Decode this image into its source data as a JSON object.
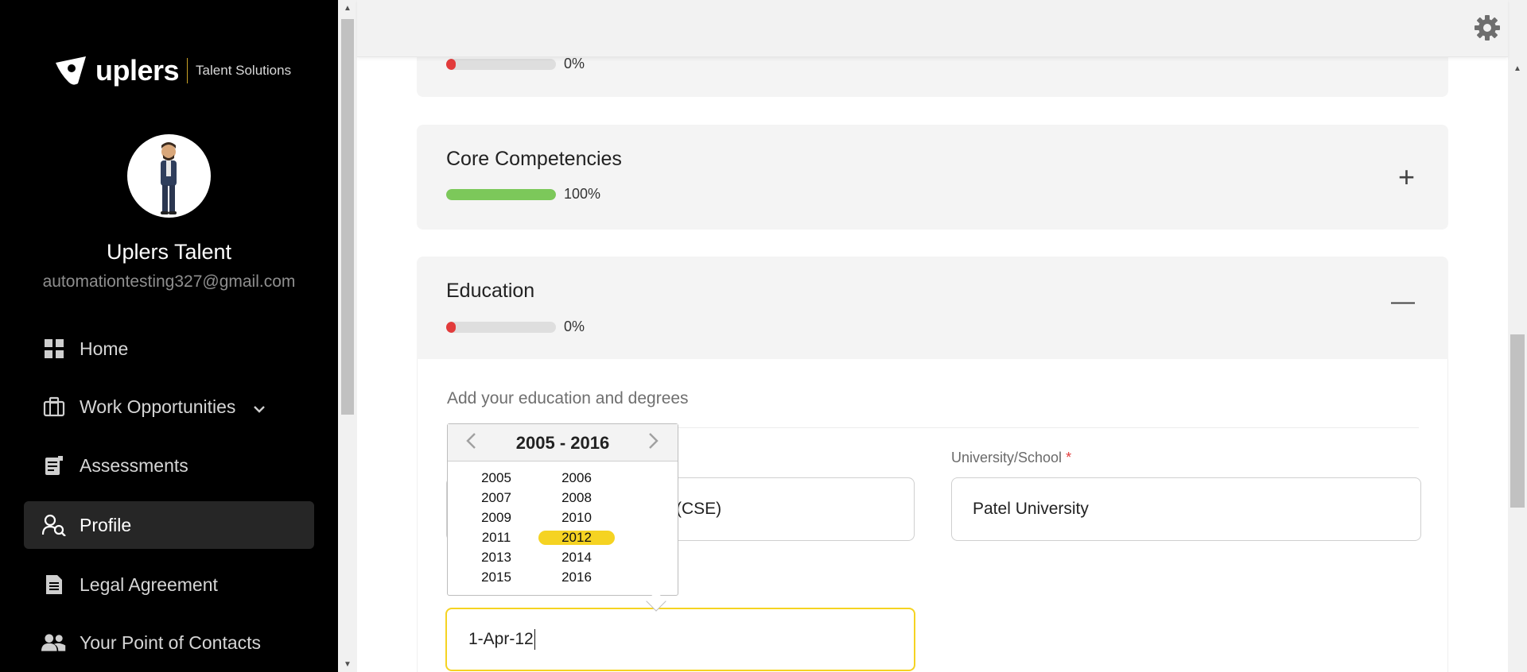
{
  "brand": {
    "name": "uplers",
    "tagline": "Talent Solutions",
    "accent": "#c9a227"
  },
  "profile": {
    "name": "Uplers Talent",
    "email": "automationtesting327@gmail.com"
  },
  "nav": {
    "items": [
      {
        "label": "Home",
        "icon": "grid-icon"
      },
      {
        "label": "Work Opportunities",
        "icon": "briefcase-icon",
        "has_submenu": true
      },
      {
        "label": "Assessments",
        "icon": "clipboard-icon"
      },
      {
        "label": "Profile",
        "icon": "user-search-icon",
        "active": true
      },
      {
        "label": "Legal Agreement",
        "icon": "document-icon"
      },
      {
        "label": "Your Point of Contacts",
        "icon": "contacts-icon"
      }
    ]
  },
  "sections": {
    "top": {
      "percent_label": "0%",
      "percent": 0
    },
    "core": {
      "title": "Core Competencies",
      "percent_label": "100%",
      "percent": 100,
      "toggle": "+"
    },
    "education": {
      "title": "Education",
      "percent_label": "0%",
      "percent": 0,
      "toggle": "—"
    }
  },
  "education_form": {
    "subtitle": "Add your education and degrees",
    "degree_value_visible": "(CSE)",
    "university_label": "University/School",
    "required_mark": "*",
    "university_value": "Patel University",
    "date_value": "1-Apr-12"
  },
  "datepicker": {
    "range_title": "2005 - 2016",
    "prev": "<",
    "next": ">",
    "years": [
      "2005",
      "2006",
      "2007",
      "2008",
      "2009",
      "2010",
      "2011",
      "2012",
      "2013",
      "2014",
      "2015",
      "2016"
    ],
    "selected": "2012"
  },
  "colors": {
    "progress_green": "#7cc85a",
    "progress_red": "#e23b3b",
    "highlight_yellow": "#f5d322"
  }
}
